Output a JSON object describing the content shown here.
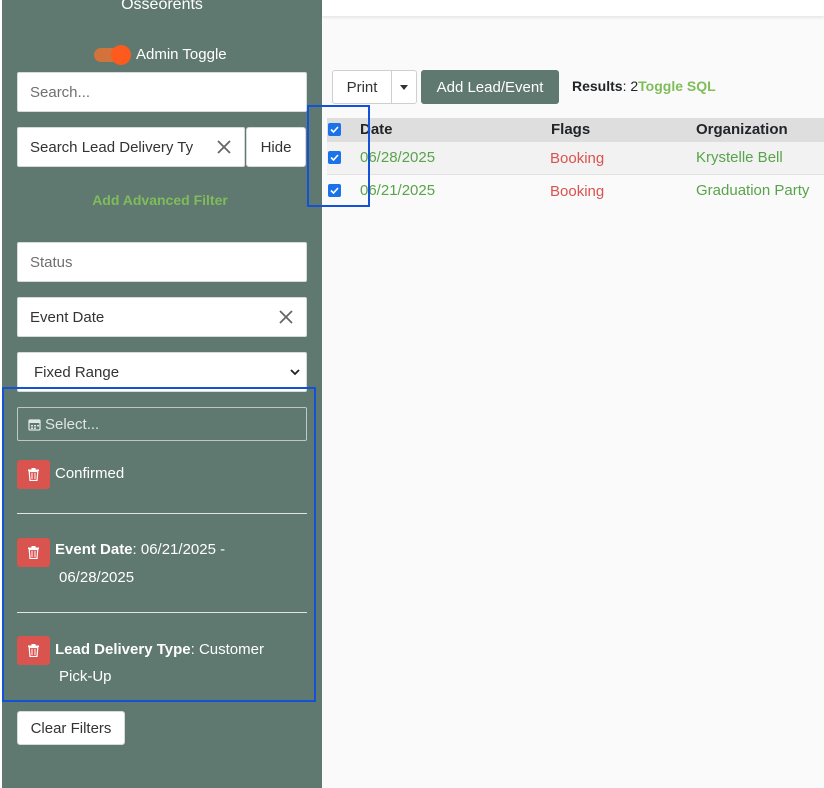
{
  "app": {
    "title": "Osseorents"
  },
  "sidebar": {
    "admin_toggle_label": "Admin Toggle",
    "search_placeholder": "Search...",
    "lead_delivery_value": "Search Lead Delivery Ty",
    "hide_label": "Hide",
    "add_advanced_filter": "Add Advanced Filter",
    "status_placeholder": "Status",
    "event_date_value": "Event Date",
    "range_select": "Fixed Range",
    "date_picker_placeholder": "Select...",
    "filters": [
      {
        "label": "",
        "value": "Confirmed"
      },
      {
        "label": "Event Date",
        "value": ": 06/21/2025 -",
        "value_cont": "06/28/2025"
      },
      {
        "label": "Lead Delivery Type",
        "value": ": Customer",
        "value_cont": "Pick-Up"
      }
    ],
    "clear_filters_label": "Clear Filters"
  },
  "toolbar": {
    "print_label": "Print",
    "add_label": "Add Lead/Event",
    "results_label": "Results",
    "results_count": ": 2",
    "toggle_sql": "Toggle SQL"
  },
  "table": {
    "headers": [
      "Date",
      "Flags",
      "Organization"
    ],
    "rows": [
      {
        "date": "06/28/2025",
        "flags": "Booking",
        "organization": "Krystelle Bell",
        "checked": true
      },
      {
        "date": "06/21/2025",
        "flags": "Booking",
        "organization": "Graduation Party",
        "checked": true
      }
    ]
  },
  "colors": {
    "sidebar": "#5f7870",
    "accent_green": "#7fbd5a",
    "danger": "#d9534f",
    "highlight": "#1351d8"
  }
}
